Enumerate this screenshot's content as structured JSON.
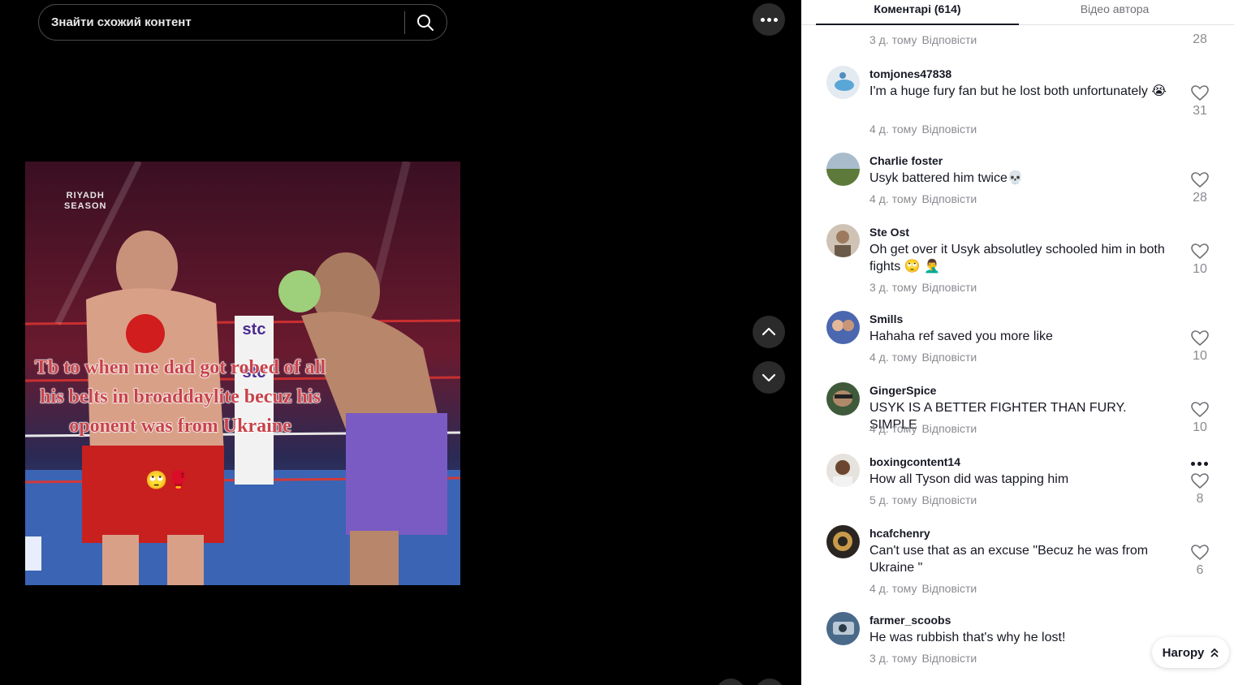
{
  "search": {
    "placeholder": "Знайти схожий контент"
  },
  "video": {
    "caption": "Tb to when me dad got robed of all his belts in broaddaylite becuz his oponent was from Ukraine",
    "caption_emoji": "🙄🥊",
    "logo_lines": [
      "RIYADH",
      "SEASON"
    ],
    "sponsor_text": "stc",
    "sponsor_text_2": "stc"
  },
  "tabs": {
    "comments": "Коментарі (614)",
    "author_videos": "Відео автора"
  },
  "top_partial": {
    "meta_time": "3 д. тому",
    "reply": "Відповісти",
    "likes": "28"
  },
  "comments": [
    {
      "user": "tomjones47838",
      "text": "I'm a huge fury fan but he lost both unfortunately 😭",
      "time": "4 д. тому",
      "reply": "Відповісти",
      "likes": "31"
    },
    {
      "user": "Charlie foster",
      "text": "Usyk battered him twice💀",
      "time": "4 д. тому",
      "reply": "Відповісти",
      "likes": "28"
    },
    {
      "user": "Ste Ost",
      "text": "Oh get over it Usyk absolutley schooled him in both fights 🙄 🤦‍♂️",
      "time": "3 д. тому",
      "reply": "Відповісти",
      "likes": "10"
    },
    {
      "user": "Smills",
      "text": "Hahaha ref saved you more like",
      "time": "4 д. тому",
      "reply": "Відповісти",
      "likes": "10"
    },
    {
      "user": "GingerSpice",
      "text": "USYK IS A BETTER FIGHTER THAN FURY. SIMPLE",
      "time": "4 д. тому",
      "reply": "Відповісти",
      "likes": "10"
    },
    {
      "user": "boxingcontent14",
      "text": "How all Tyson did was tapping him",
      "time": "5 д. тому",
      "reply": "Відповісти",
      "likes": "8"
    },
    {
      "user": "hcafchenry",
      "text": "Can't use that as an excuse \"Becuz he was from Ukraine \"",
      "time": "4 д. тому",
      "reply": "Відповісти",
      "likes": "6"
    },
    {
      "user": "farmer_scoobs",
      "text": "He was rubbish that's why he lost!",
      "time": "3 д. тому",
      "reply": "Відповісти",
      "likes": ""
    }
  ],
  "back_to_top": "Нагору",
  "colors": {
    "panel_bg": "#ffffff",
    "text_primary": "#161823",
    "text_secondary": "#8a8b91",
    "dark_btn": "#2b2b2b"
  }
}
